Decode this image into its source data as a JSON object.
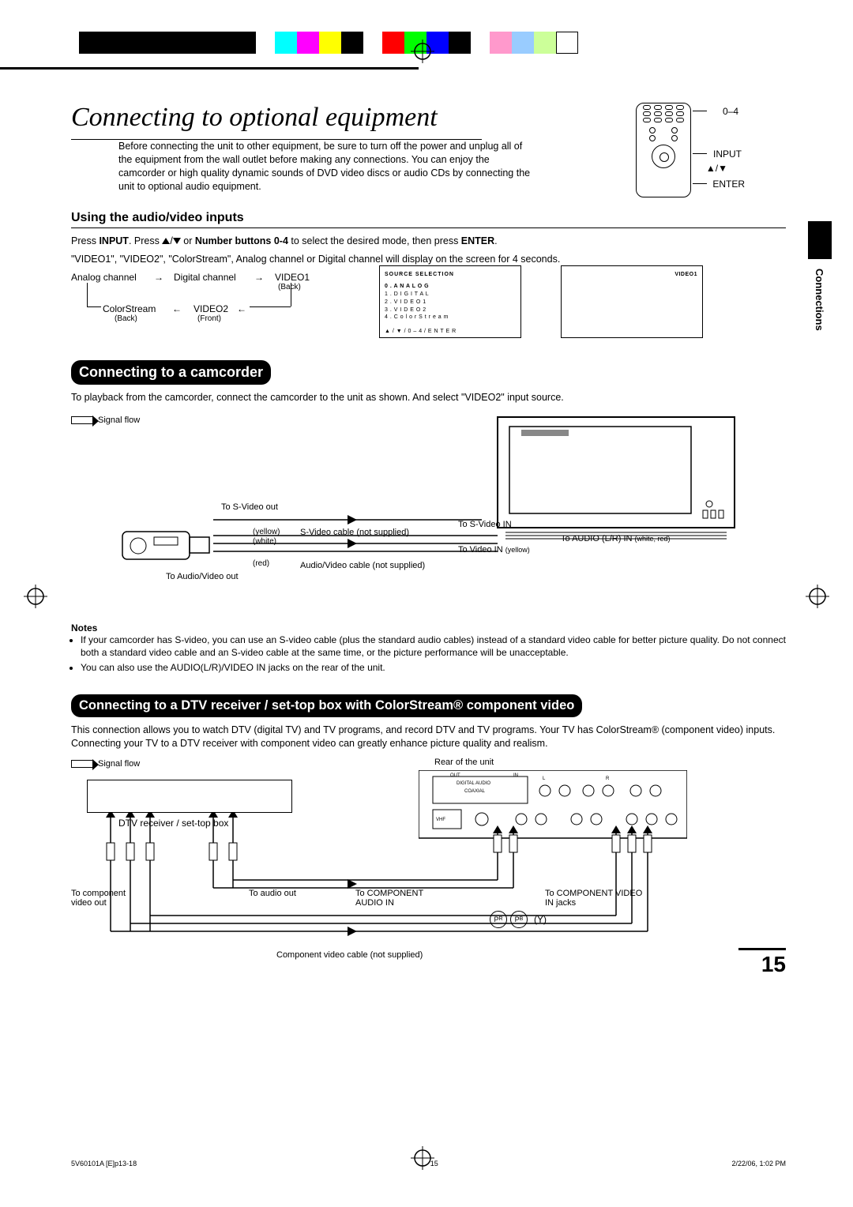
{
  "printmarks": {
    "swatches": [
      "#000",
      "#000",
      "#000",
      "#000",
      "#000",
      "#000",
      "#000",
      "#000",
      "#0ff",
      "#f0f",
      "#ff0",
      "#000",
      "#f00",
      "#0f0",
      "#00f",
      "#000",
      "#f9c",
      "#9cf",
      "#cf9",
      "#fff"
    ]
  },
  "remote_labels": {
    "range": "0–4",
    "input": "INPUT",
    "arrows": "▲/▼",
    "enter": "ENTER"
  },
  "title": "Connecting to optional equipment",
  "intro": "Before connecting the unit to other equipment, be sure to turn off the power and unplug all of the equipment from the wall outlet before making any connections. You can enjoy the camcorder or high quality dynamic sounds of DVD video discs or audio CDs by connecting the unit to optional audio equipment.",
  "section1": {
    "heading": "Using the audio/video inputs",
    "para_parts": {
      "p1a": "Press ",
      "p1b": "INPUT",
      "p1c": ". Press ",
      "p1d": " or ",
      "p1e": "Number buttons 0-4",
      "p1f": " to select the desired mode, then press ",
      "p1g": "ENTER",
      "p1h": "."
    },
    "para2": "\"VIDEO1\", \"VIDEO2\", \"ColorStream\", Analog channel or Digital channel will display on the screen for 4 seconds.",
    "flow": {
      "analog": "Analog channel",
      "digital": "Digital channel",
      "video1": "VIDEO1",
      "video1_sub": "(Back)",
      "colorstream": "ColorStream",
      "cs_sub": "(Back)",
      "video2": "VIDEO2",
      "video2_sub": "(Front)"
    },
    "osd1": {
      "title": "SOURCE SELECTION",
      "items": [
        "0 . A N A L O G",
        "1 . D I G I T A L",
        "2 . V I D E O 1",
        "3 . V I D E O 2",
        "4 . C o l o r S t r e a m"
      ],
      "hint": "▲ / ▼ / 0 – 4 / E N T E R"
    },
    "osd2_label": "VIDEO1"
  },
  "side_tab": "Connections",
  "section2": {
    "heading": "Connecting to a camcorder",
    "para": "To playback from the camcorder, connect the camcorder to the unit as shown. And select \"VIDEO2\" input source.",
    "signal_flow": "Signal flow",
    "labels": {
      "to_svideo_out": "To S-Video out",
      "yellow": "(yellow)",
      "white": "(white)",
      "red": "(red)",
      "to_av_out": "To Audio/Video out",
      "svideo_cable": "S-Video cable (not supplied)",
      "av_cable": "Audio/Video cable (not supplied)",
      "to_svideo_in": "To S-Video IN",
      "to_video_in": "To Video IN",
      "yellow2": "(yellow)",
      "to_audio_lr": "To AUDIO (L/R) IN",
      "white_red": "(white, red)"
    },
    "notes_heading": "Notes",
    "notes": [
      "If your camcorder has S-video, you can use an S-video cable (plus the standard audio cables) instead of a standard video cable for better picture quality. Do not connect both a standard video cable and an S-video cable at the same time, or the picture performance will be unacceptable.",
      "You can also use the AUDIO(L/R)/VIDEO IN jacks on the rear of the unit."
    ]
  },
  "section3": {
    "heading": "Connecting to a DTV receiver / set-top box with ColorStream® component video",
    "para": "This connection allows you to watch DTV (digital TV) and TV programs, and record DTV and TV programs. Your TV has ColorStream® (component video) inputs. Connecting your TV to a DTV receiver with component video can greatly enhance picture quality and realism.",
    "signal_flow": "Signal flow",
    "labels": {
      "dtv": "DTV receiver / set-top box",
      "rear": "Rear of the unit",
      "to_comp_out": "To component video out",
      "to_audio_out": "To audio out",
      "to_comp_audio_in": "To COMPONENT AUDIO IN",
      "to_comp_video_in": "To COMPONENT VIDEO IN jacks",
      "pr": "PR",
      "pb": "PB",
      "y": "(Y)",
      "comp_cable": "Component video cable (not supplied)",
      "rear_labels": {
        "digital_audio": "DIGITAL AUDIO",
        "coaxial": "COAXIAL",
        "vhf": "VHF",
        "out": "OUT",
        "in": "IN",
        "l": "L",
        "r": "R"
      }
    }
  },
  "page_number": "15",
  "footer": {
    "left": "5V60101A [E]p13-18",
    "center": "15",
    "right": "2/22/06, 1:02 PM"
  }
}
